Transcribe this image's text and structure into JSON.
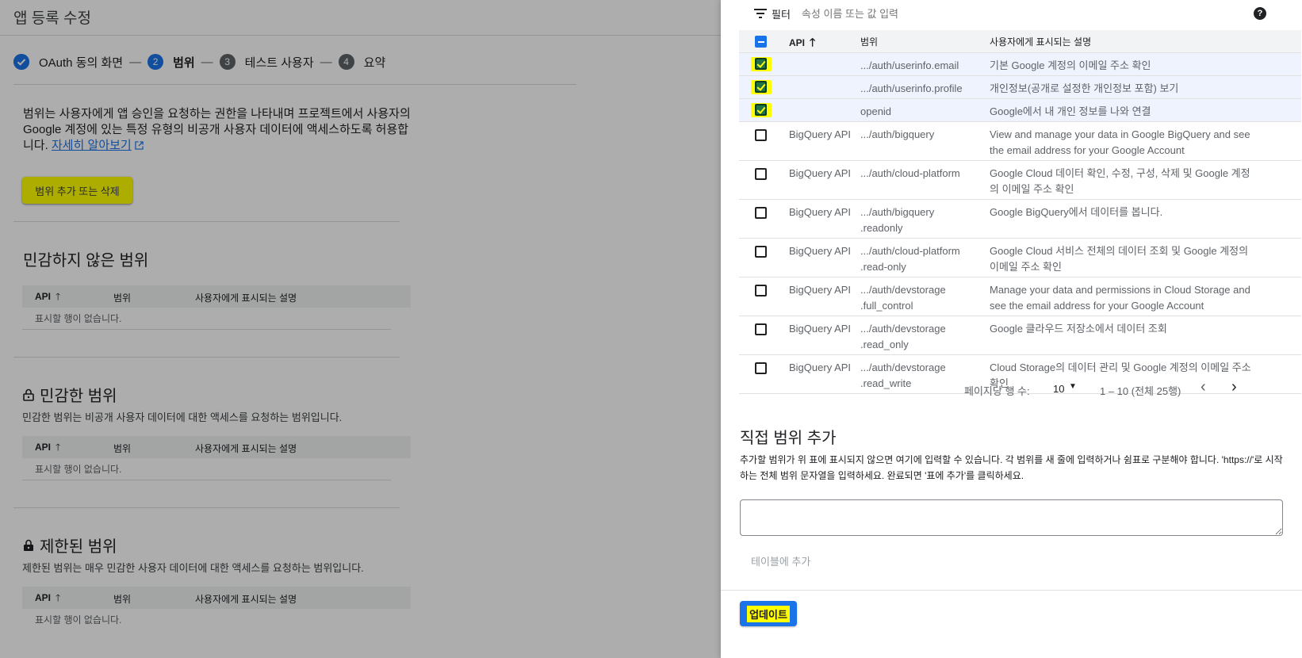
{
  "page": {
    "title": "앱 등록 수정",
    "steps": [
      {
        "num": "",
        "label": "OAuth 동의 화면",
        "state": "done"
      },
      {
        "num": "2",
        "label": "범위",
        "state": "active"
      },
      {
        "num": "3",
        "label": "테스트 사용자",
        "state": "pending"
      },
      {
        "num": "4",
        "label": "요약",
        "state": "pending"
      }
    ],
    "step_separator": "—",
    "intro_text": "범위는 사용자에게 앱 승인을 요청하는 권한을 나타내며 프로젝트에서 사용자의 Google 계정에 있는 특정 유형의 비공개 사용자 데이터에 액세스하도록 허용합니다.",
    "learn_more": "자세히 알아보기",
    "add_remove_button": "범위 추가 또는 삭제",
    "columns": {
      "api": "API",
      "scope": "범위",
      "description": "사용자에게 표시되는 설명"
    },
    "empty_text": "표시할 행이 없습니다.",
    "non_sensitive": {
      "title": "민감하지 않은 범위"
    },
    "sensitive": {
      "title": "민감한 범위",
      "desc": "민감한 범위는 비공개 사용자 데이터에 대한 액세스를 요청하는 범위입니다."
    },
    "restricted": {
      "title": "제한된 범위",
      "desc": "제한된 범위는 매우 민감한 사용자 데이터에 대한 액세스를 요청하는 범위입니다."
    }
  },
  "panel": {
    "filter_label": "필터",
    "filter_placeholder": "속성 이름 또는 값 입력",
    "help_icon": "?",
    "columns": {
      "api": "API",
      "scope": "범위",
      "description": "사용자에게 표시되는 설명"
    },
    "rows": [
      {
        "checked": true,
        "api": "",
        "scope": ".../auth/userinfo.email",
        "description": "기본 Google 계정의 이메일 주소 확인"
      },
      {
        "checked": true,
        "api": "",
        "scope": ".../auth/userinfo.profile",
        "description": "개인정보(공개로 설정한 개인정보 포함) 보기"
      },
      {
        "checked": true,
        "api": "",
        "scope": "openid",
        "description": "Google에서 내 개인 정보를 나와 연결"
      },
      {
        "checked": false,
        "api": "BigQuery API",
        "scope": ".../auth/bigquery",
        "description": "View and manage your data in Google BigQuery and see the email address for your Google Account"
      },
      {
        "checked": false,
        "api": "BigQuery API",
        "scope": ".../auth/cloud-platform",
        "description": "Google Cloud 데이터 확인, 수정, 구성, 삭제 및 Google 계정의 이메일 주소 확인"
      },
      {
        "checked": false,
        "api": "BigQuery API",
        "scope": ".../auth/bigquery .readonly",
        "description": "Google BigQuery에서 데이터를 봅니다."
      },
      {
        "checked": false,
        "api": "BigQuery API",
        "scope": ".../auth/cloud-platform .read-only",
        "description": "Google Cloud 서비스 전체의 데이터 조회 및 Google 계정의 이메일 주소 확인"
      },
      {
        "checked": false,
        "api": "BigQuery API",
        "scope": ".../auth/devstorage .full_control",
        "description": "Manage your data and permissions in Cloud Storage and see the email address for your Google Account"
      },
      {
        "checked": false,
        "api": "BigQuery API",
        "scope": ".../auth/devstorage .read_only",
        "description": "Google 클라우드 저장소에서 데이터 조회"
      },
      {
        "checked": false,
        "api": "BigQuery API",
        "scope": ".../auth/devstorage .read_write",
        "description": "Cloud Storage의 데이터 관리 및 Google 계정의 이메일 주소 확인"
      }
    ],
    "pagination": {
      "rows_per_page_label": "페이지당 행 수:",
      "rows_per_page": "10",
      "range": "1 – 10 (전체 25행)"
    },
    "manual": {
      "title": "직접 범위 추가",
      "desc": "추가할 범위가 위 표에 표시되지 않으면 여기에 입력할 수 있습니다. 각 범위를 새 줄에 입력하거나 쉼표로 구분해야 합니다. 'https://'로 시작하는 전체 범위 문자열을 입력하세요. 완료되면 '표에 추가'를 클릭하세요.",
      "textarea_value": "",
      "add_button": "테이블에 추가"
    },
    "update_button": "업데이트"
  }
}
